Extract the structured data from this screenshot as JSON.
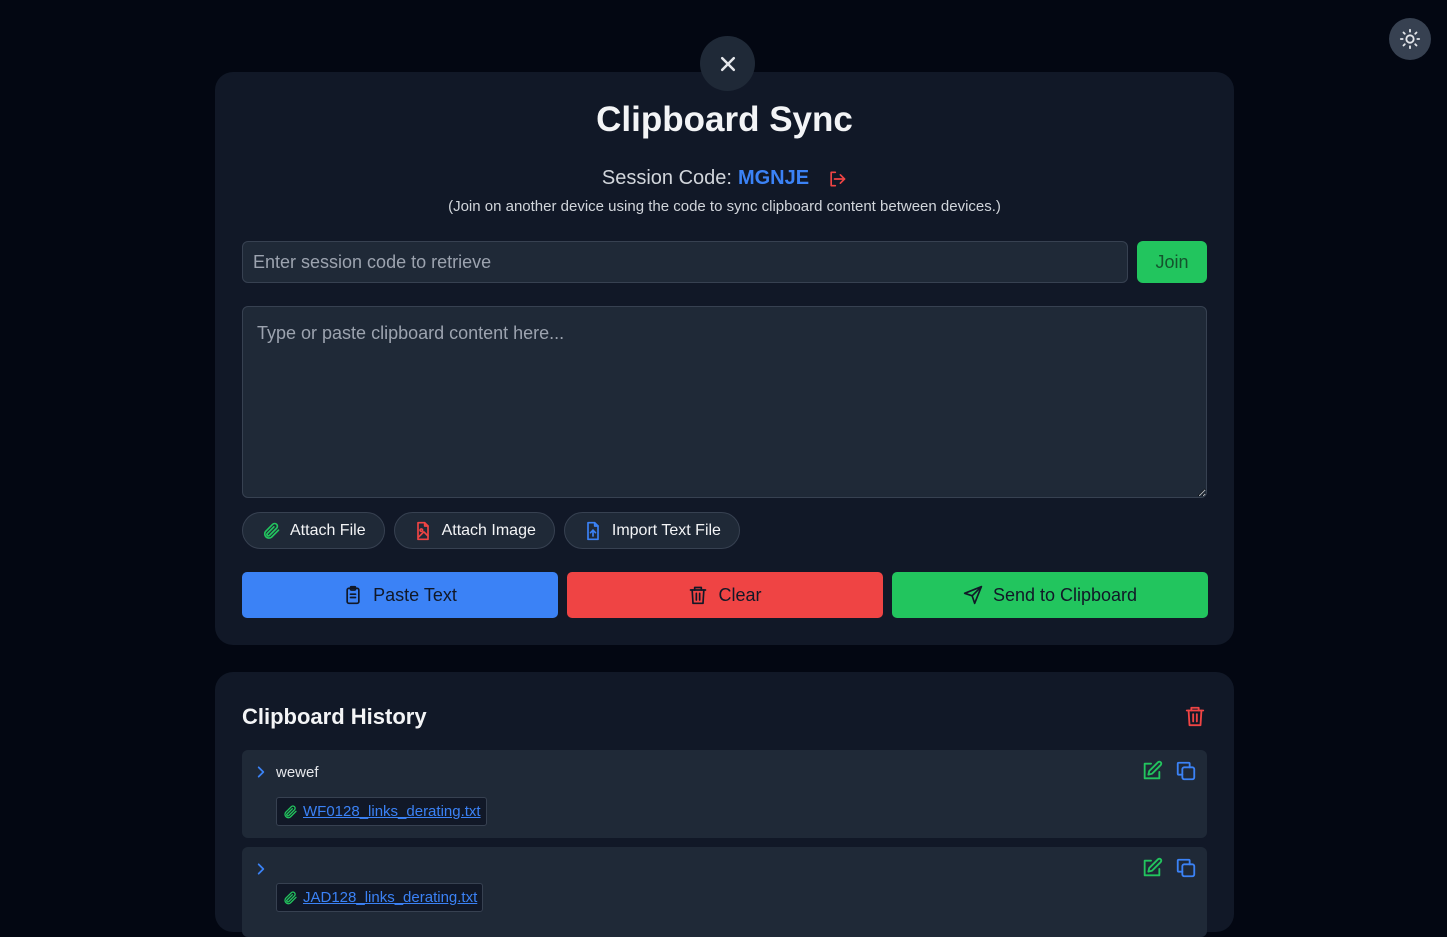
{
  "header": {
    "title": "Clipboard Sync",
    "session_label": "Session Code:",
    "session_code": "MGNJE",
    "session_hint": "(Join on another device using the code to sync clipboard content between devices.)"
  },
  "join": {
    "placeholder": "Enter session code to retrieve",
    "value": "",
    "button_label": "Join"
  },
  "editor": {
    "placeholder": "Type or paste clipboard content here...",
    "value": ""
  },
  "attachments": {
    "attach_file": "Attach File",
    "attach_image": "Attach Image",
    "import_text": "Import Text File"
  },
  "actions": {
    "paste": "Paste Text",
    "clear": "Clear",
    "send": "Send to Clipboard"
  },
  "history": {
    "title": "Clipboard History",
    "items": [
      {
        "text": "wewef",
        "file": "WF0128_links_derating.txt"
      },
      {
        "text": "",
        "file": "JAD128_links_derating.txt"
      }
    ]
  },
  "colors": {
    "accent_blue": "#3b82f6",
    "accent_red": "#ef4444",
    "accent_green": "#22c55e"
  },
  "icons": {
    "theme": "sun-icon",
    "close": "close-icon",
    "leave": "logout-icon",
    "attach_file": "paperclip-icon",
    "attach_image": "file-image-icon",
    "import_text": "file-upload-icon",
    "paste": "clipboard-icon",
    "clear": "trash-icon",
    "send": "send-icon",
    "edit": "edit-icon",
    "copy": "copy-icon",
    "expand": "chevron-right-icon"
  }
}
